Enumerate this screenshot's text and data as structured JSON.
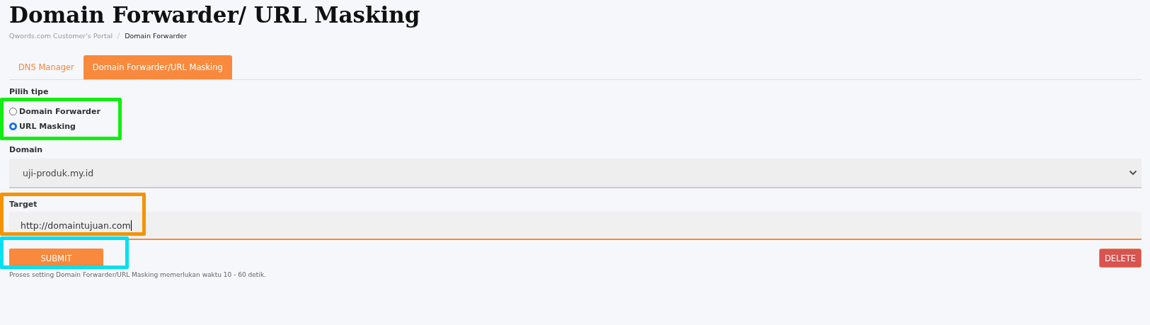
{
  "page_title": "Domain Forwarder/ URL Masking",
  "breadcrumb": [
    {
      "label": "Qwords.com Customer's Portal",
      "current": false
    },
    {
      "label": "Domain Forwarder",
      "current": true
    }
  ],
  "tabs": [
    {
      "label": "DNS Manager",
      "selected": false
    },
    {
      "label": "Domain Forwarder/URL Masking",
      "selected": true
    }
  ],
  "type_label": "Pilih tipe",
  "types": [
    {
      "label": "Domain Forwarder",
      "selected": false
    },
    {
      "label": "URL Masking",
      "selected": true
    }
  ],
  "domain": {
    "label": "Domain",
    "value": "uji-produk.my.id"
  },
  "target": {
    "label": "Target",
    "value": "http://domaintujuan.com"
  },
  "submit_button": "SUBMIT",
  "note": "Proses setting Domain Forwarder/URL Masking memerlukan waktu 10 - 60 detik.",
  "delete_button": "DELETE",
  "highlight_frames": [
    {
      "color": "#11ee11"
    },
    {
      "color": "#f59300"
    },
    {
      "color": "#00e0f0"
    }
  ]
}
